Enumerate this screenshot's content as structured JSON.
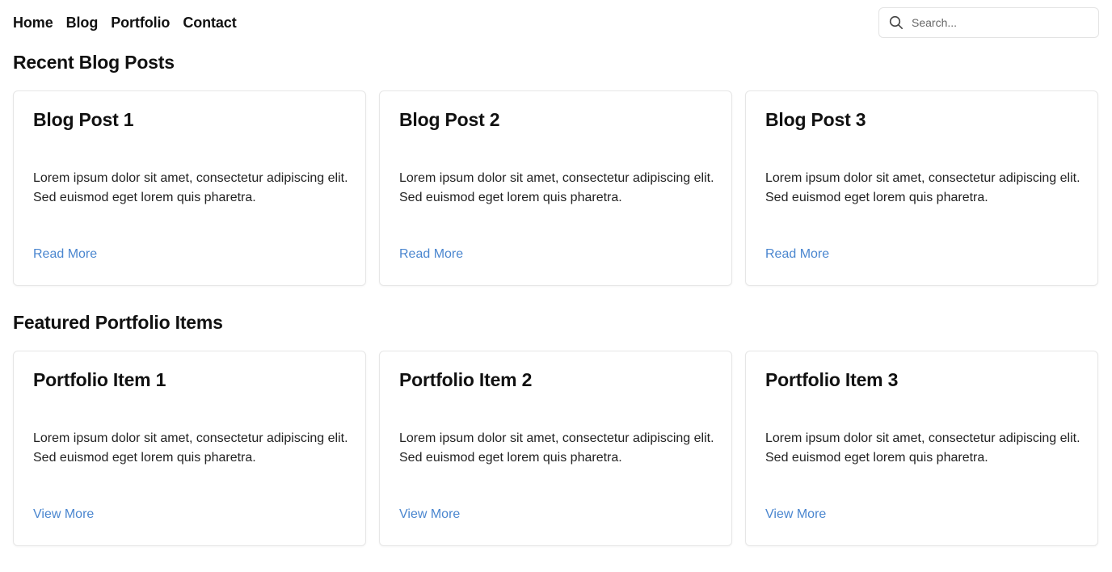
{
  "colors": {
    "link": "#4a86cf",
    "text": "#111111",
    "border": "#e6e6e6",
    "background": "#ffffff"
  },
  "nav": {
    "links": [
      "Home",
      "Blog",
      "Portfolio",
      "Contact"
    ]
  },
  "search": {
    "icon": "search-icon",
    "placeholder": "Search..."
  },
  "blog": {
    "title": "Recent Blog Posts",
    "cards": [
      {
        "title": "Blog Post 1",
        "text": "Lorem ipsum dolor sit amet, consectetur adipiscing elit. Sed euismod eget lorem quis pharetra.",
        "link": "Read More"
      },
      {
        "title": "Blog Post 2",
        "text": "Lorem ipsum dolor sit amet, consectetur adipiscing elit. Sed euismod eget lorem quis pharetra.",
        "link": "Read More"
      },
      {
        "title": "Blog Post 3",
        "text": "Lorem ipsum dolor sit amet, consectetur adipiscing elit. Sed euismod eget lorem quis pharetra.",
        "link": "Read More"
      }
    ]
  },
  "portfolio": {
    "title": "Featured Portfolio Items",
    "cards": [
      {
        "title": "Portfolio Item 1",
        "text": "Lorem ipsum dolor sit amet, consectetur adipiscing elit. Sed euismod eget lorem quis pharetra.",
        "link": "View More"
      },
      {
        "title": "Portfolio Item 2",
        "text": "Lorem ipsum dolor sit amet, consectetur adipiscing elit. Sed euismod eget lorem quis pharetra.",
        "link": "View More"
      },
      {
        "title": "Portfolio Item 3",
        "text": "Lorem ipsum dolor sit amet, consectetur adipiscing elit. Sed euismod eget lorem quis pharetra.",
        "link": "View More"
      }
    ]
  }
}
